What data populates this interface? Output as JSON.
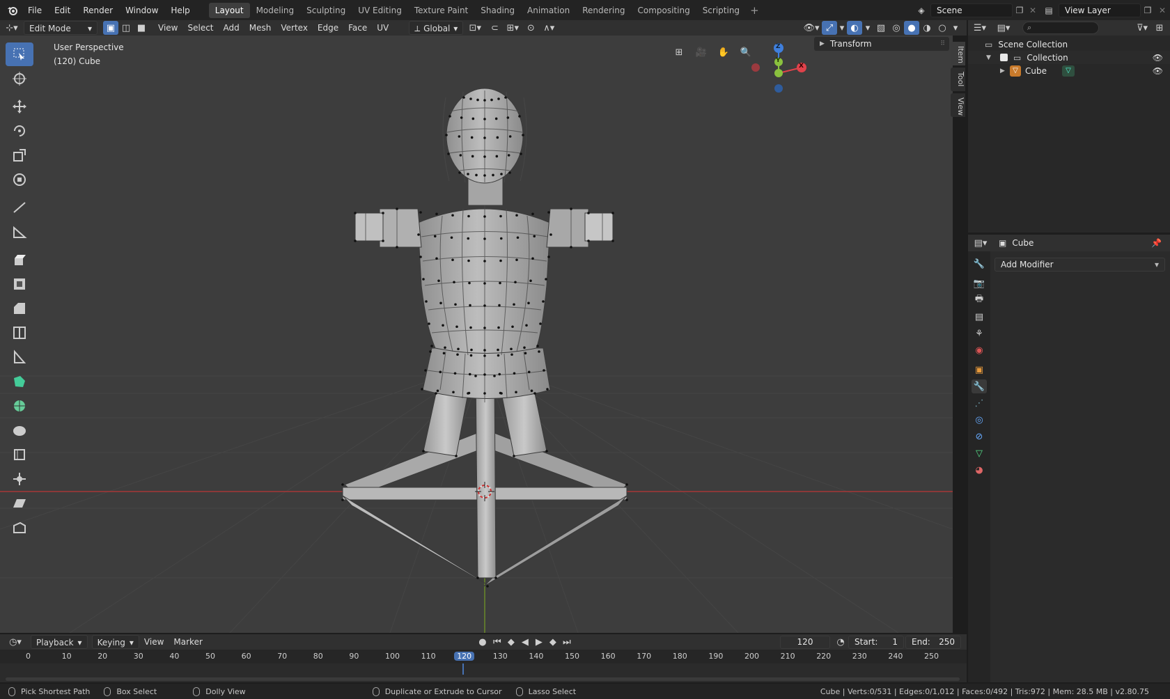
{
  "topbar": {
    "menus": [
      "File",
      "Edit",
      "Render",
      "Window",
      "Help"
    ],
    "workspaces": [
      "Layout",
      "Modeling",
      "Sculpting",
      "UV Editing",
      "Texture Paint",
      "Shading",
      "Animation",
      "Rendering",
      "Compositing",
      "Scripting"
    ],
    "active_workspace": "Layout",
    "scene": "Scene",
    "view_layer": "View Layer"
  },
  "viewhdr": {
    "mode": "Edit Mode",
    "menus": [
      "View",
      "Select",
      "Add",
      "Mesh",
      "Vertex",
      "Edge",
      "Face",
      "UV"
    ],
    "orientation": "Global"
  },
  "viewport": {
    "perspective": "User Perspective",
    "object_label": "(120) Cube",
    "transform_panel": "Transform",
    "side_tabs": [
      "Item",
      "Tool",
      "View"
    ],
    "gizmo": {
      "x": "X",
      "y": "Y",
      "z": "Z"
    }
  },
  "outliner": {
    "root": "Scene Collection",
    "collection": "Collection",
    "object": "Cube"
  },
  "properties": {
    "object_name": "Cube",
    "add_modifier": "Add Modifier"
  },
  "timeline": {
    "menus": [
      "Playback",
      "Keying",
      "View",
      "Marker"
    ],
    "current_frame": "120",
    "start_label": "Start:",
    "start": "1",
    "end_label": "End:",
    "end": "250",
    "ticks": [
      "0",
      "10",
      "20",
      "30",
      "40",
      "50",
      "60",
      "70",
      "80",
      "90",
      "100",
      "110",
      "120",
      "130",
      "140",
      "150",
      "160",
      "170",
      "180",
      "190",
      "200",
      "210",
      "220",
      "230",
      "240",
      "250"
    ]
  },
  "statusbar": {
    "items": [
      "Pick Shortest Path",
      "Box Select",
      "Dolly View",
      "Duplicate or Extrude to Cursor",
      "Lasso Select"
    ],
    "stats": "Cube | Verts:0/531 | Edges:0/1,012 | Faces:0/492 | Tris:972 | Mem: 28.5 MB | v2.80.75"
  },
  "colors": {
    "accent": "#4772b3",
    "x_axis": "#e0424b",
    "y_axis": "#8ac13e",
    "z_axis": "#3f7fdd"
  }
}
